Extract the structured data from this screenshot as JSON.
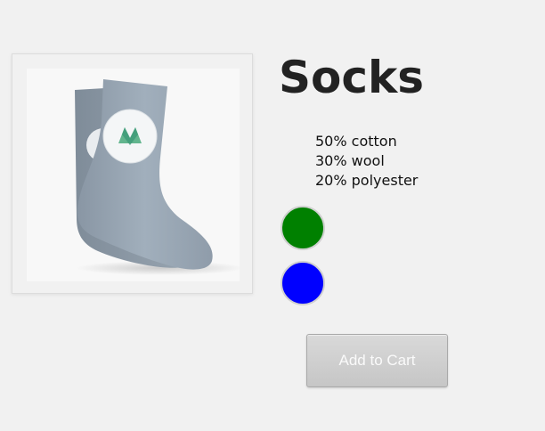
{
  "product": {
    "title": "Socks",
    "image_icon": "socks-product-image",
    "materials": [
      "50% cotton",
      "30% wool",
      "20% polyester"
    ],
    "color_options": [
      {
        "name": "green",
        "color": "#008000"
      },
      {
        "name": "blue",
        "color": "#0000ff"
      }
    ]
  },
  "actions": {
    "add_to_cart_label": "Add to Cart"
  }
}
